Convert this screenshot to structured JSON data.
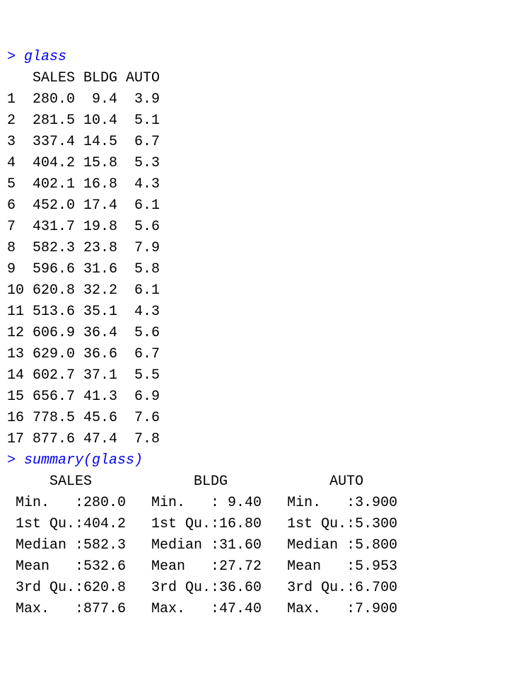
{
  "console": {
    "prompt": "> ",
    "cmd1": "glass",
    "cmd2": "summary(glass)",
    "header": "   SALES BLDG AUTO",
    "rows": [
      "1  280.0  9.4  3.9",
      "2  281.5 10.4  5.1",
      "3  337.4 14.5  6.7",
      "4  404.2 15.8  5.3",
      "5  402.1 16.8  4.3",
      "6  452.0 17.4  6.1",
      "7  431.7 19.8  5.6",
      "8  582.3 23.8  7.9",
      "9  596.6 31.6  5.8",
      "10 620.8 32.2  6.1",
      "11 513.6 35.1  4.3",
      "12 606.9 36.4  5.6",
      "13 629.0 36.6  6.7",
      "14 602.7 37.1  5.5",
      "15 656.7 41.3  6.9",
      "16 778.5 45.6  7.6",
      "17 877.6 47.4  7.8"
    ],
    "summary": [
      "     SALES            BLDG            AUTO      ",
      " Min.   :280.0   Min.   : 9.40   Min.   :3.900  ",
      " 1st Qu.:404.2   1st Qu.:16.80   1st Qu.:5.300  ",
      " Median :582.3   Median :31.60   Median :5.800  ",
      " Mean   :532.6   Mean   :27.72   Mean   :5.953  ",
      " 3rd Qu.:620.8   3rd Qu.:36.60   3rd Qu.:6.700  ",
      " Max.   :877.6   Max.   :47.40   Max.   :7.900  "
    ]
  },
  "chart_data": {
    "type": "table",
    "title": "glass",
    "columns": [
      "SALES",
      "BLDG",
      "AUTO"
    ],
    "rows": [
      {
        "row": 1,
        "SALES": 280.0,
        "BLDG": 9.4,
        "AUTO": 3.9
      },
      {
        "row": 2,
        "SALES": 281.5,
        "BLDG": 10.4,
        "AUTO": 5.1
      },
      {
        "row": 3,
        "SALES": 337.4,
        "BLDG": 14.5,
        "AUTO": 6.7
      },
      {
        "row": 4,
        "SALES": 404.2,
        "BLDG": 15.8,
        "AUTO": 5.3
      },
      {
        "row": 5,
        "SALES": 402.1,
        "BLDG": 16.8,
        "AUTO": 4.3
      },
      {
        "row": 6,
        "SALES": 452.0,
        "BLDG": 17.4,
        "AUTO": 6.1
      },
      {
        "row": 7,
        "SALES": 431.7,
        "BLDG": 19.8,
        "AUTO": 5.6
      },
      {
        "row": 8,
        "SALES": 582.3,
        "BLDG": 23.8,
        "AUTO": 7.9
      },
      {
        "row": 9,
        "SALES": 596.6,
        "BLDG": 31.6,
        "AUTO": 5.8
      },
      {
        "row": 10,
        "SALES": 620.8,
        "BLDG": 32.2,
        "AUTO": 6.1
      },
      {
        "row": 11,
        "SALES": 513.6,
        "BLDG": 35.1,
        "AUTO": 4.3
      },
      {
        "row": 12,
        "SALES": 606.9,
        "BLDG": 36.4,
        "AUTO": 5.6
      },
      {
        "row": 13,
        "SALES": 629.0,
        "BLDG": 36.6,
        "AUTO": 6.7
      },
      {
        "row": 14,
        "SALES": 602.7,
        "BLDG": 37.1,
        "AUTO": 5.5
      },
      {
        "row": 15,
        "SALES": 656.7,
        "BLDG": 41.3,
        "AUTO": 6.9
      },
      {
        "row": 16,
        "SALES": 778.5,
        "BLDG": 45.6,
        "AUTO": 7.6
      },
      {
        "row": 17,
        "SALES": 877.6,
        "BLDG": 47.4,
        "AUTO": 7.8
      }
    ],
    "summary": {
      "SALES": {
        "Min": 280.0,
        "1st Qu": 404.2,
        "Median": 582.3,
        "Mean": 532.6,
        "3rd Qu": 620.8,
        "Max": 877.6
      },
      "BLDG": {
        "Min": 9.4,
        "1st Qu": 16.8,
        "Median": 31.6,
        "Mean": 27.72,
        "3rd Qu": 36.6,
        "Max": 47.4
      },
      "AUTO": {
        "Min": 3.9,
        "1st Qu": 5.3,
        "Median": 5.8,
        "Mean": 5.953,
        "3rd Qu": 6.7,
        "Max": 7.9
      }
    }
  }
}
